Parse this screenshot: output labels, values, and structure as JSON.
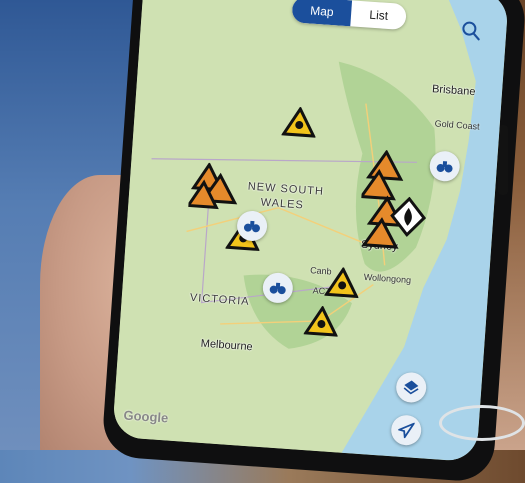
{
  "tabs": {
    "map_label": "Map",
    "list_label": "List",
    "active": "Map"
  },
  "map": {
    "regions": {
      "nsw_line1": "NEW SOUTH",
      "nsw_line2": "WALES",
      "victoria": "VICTORIA",
      "act": "ACT"
    },
    "cities": {
      "brisbane": "Brisbane",
      "gold_coast": "Gold Coast",
      "sydney": "Sydney",
      "wollongong": "Wollongong",
      "canberra": "Canb",
      "melbourne": "Melbourne"
    },
    "attribution": "Google"
  },
  "colors": {
    "accent": "#1b4f9c",
    "warning_yellow": "#f2c31b",
    "warning_orange": "#e58a2b",
    "land": "#cfe1b2",
    "sea": "#a9d3ea"
  },
  "icons": [
    "search-icon",
    "layers-icon",
    "navigate-icon",
    "binoculars-icon",
    "storm-warning-icon",
    "fire-warning-icon"
  ]
}
